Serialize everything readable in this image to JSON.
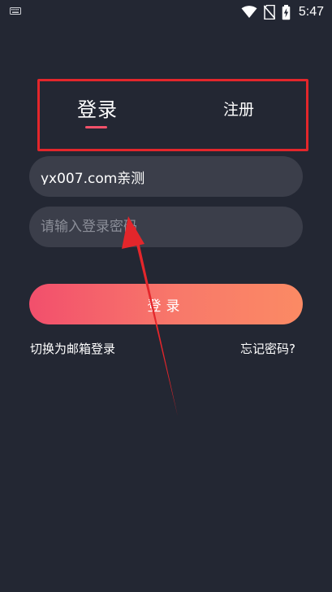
{
  "status_bar": {
    "time": "5:47",
    "icons": [
      "keyboard-icon",
      "wifi-icon",
      "no-sim-icon",
      "battery-charging-icon"
    ]
  },
  "tabs": {
    "login_label": "登录",
    "register_label": "注册"
  },
  "form": {
    "account_value": "yx007.com亲测",
    "password_placeholder": "请输入登录密码"
  },
  "actions": {
    "login_button": "登录",
    "switch_email": "切换为邮箱登录",
    "forgot_password": "忘记密码?"
  },
  "colors": {
    "background": "#232733",
    "field_bg": "#3b3e4a",
    "accent": "#f2516a",
    "gradient_end": "#fb8a64",
    "annotation_red": "#e3262b"
  }
}
